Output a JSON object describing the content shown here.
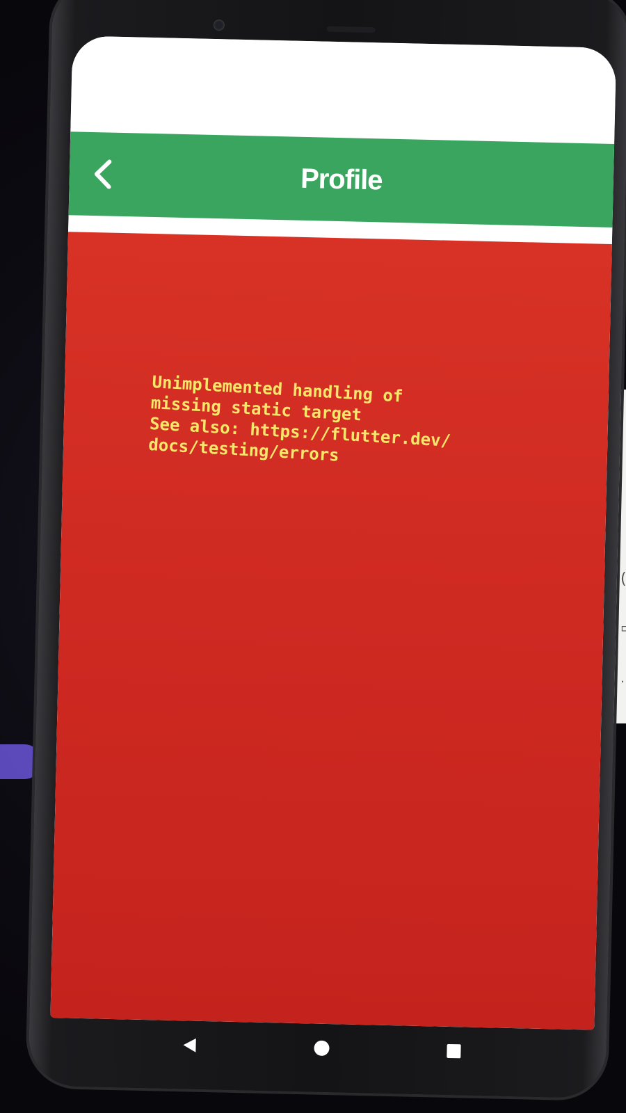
{
  "app_bar": {
    "title": "Profile",
    "back_icon": "chevron-left-icon"
  },
  "error": {
    "message": "Unimplemented handling of\nmissing static target\nSee also: https://flutter.dev/\ndocs/testing/errors"
  },
  "nav_bar": {
    "back_icon": "triangle-back-icon",
    "home_icon": "circle-home-icon",
    "recents_icon": "square-recents-icon"
  },
  "colors": {
    "app_bar": "#3aa55f",
    "error_background": "#d0291f",
    "error_text": "#f6e66a"
  }
}
